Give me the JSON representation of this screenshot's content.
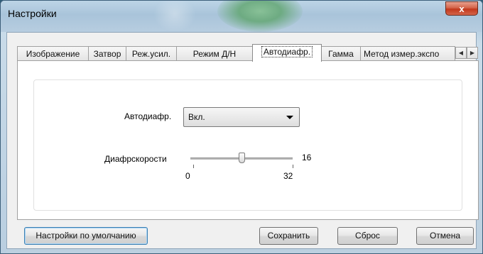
{
  "window": {
    "title": "Настройки",
    "close_label": "x"
  },
  "tabs": [
    {
      "label": "Изображение",
      "active": false
    },
    {
      "label": "Затвор",
      "active": false
    },
    {
      "label": "Реж.усил.",
      "active": false
    },
    {
      "label": "Режим Д/Н",
      "active": false
    },
    {
      "label": "Автодиафр.",
      "active": true
    },
    {
      "label": "Гамма",
      "active": false
    },
    {
      "label": "Метод измер.экспо",
      "active": false
    }
  ],
  "tab_scroll": {
    "left_glyph": "◀",
    "right_glyph": "▶"
  },
  "settings": {
    "autoiris_label": "Автодиафр.",
    "autoiris_value": "Вкл.",
    "iris_speed_label": "Диафрскорости",
    "iris_speed_value": "16",
    "iris_speed_min": "0",
    "iris_speed_max": "32",
    "iris_speed_fraction": 0.5
  },
  "buttons": {
    "defaults": "Настройки по умолчанию",
    "save": "Сохранить",
    "reset": "Сброс",
    "cancel": "Отмена"
  },
  "colors": {
    "close_button": "#c9432a",
    "focused_button_border": "#3c7fb1"
  }
}
